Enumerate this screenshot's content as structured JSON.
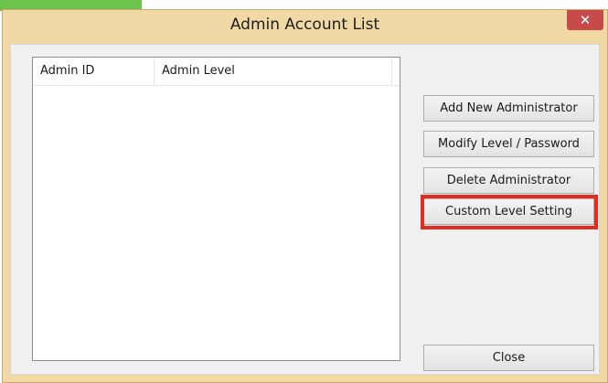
{
  "window": {
    "title": "Admin Account List",
    "close_glyph": "✕"
  },
  "list": {
    "columns": [
      "Admin ID",
      "Admin Level"
    ],
    "rows": []
  },
  "buttons": {
    "add": "Add New Administrator",
    "modify": "Modify Level / Password",
    "delete": "Delete Administrator",
    "custom": "Custom Level Setting",
    "close": "Close"
  },
  "colors": {
    "title_bar": "#f0d9a4",
    "close_button": "#c74b4b",
    "highlight": "#e62b1e",
    "accent_green": "#6cc24a"
  },
  "icons": {
    "close": "close-icon"
  }
}
